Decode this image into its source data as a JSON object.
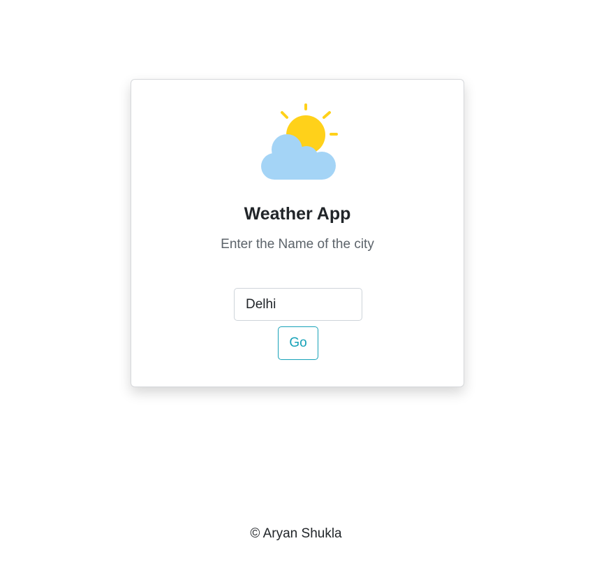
{
  "app": {
    "title": "Weather App",
    "subtitle": "Enter the Name of the city"
  },
  "search": {
    "value": "Delhi",
    "button_label": "Go"
  },
  "footer": {
    "text": "© Aryan Shukla"
  },
  "icons": {
    "weather": "sun-behind-cloud-icon"
  },
  "colors": {
    "accent": "#17a2b8",
    "sun": "#ffd11a",
    "cloud": "#a4d4f6"
  }
}
